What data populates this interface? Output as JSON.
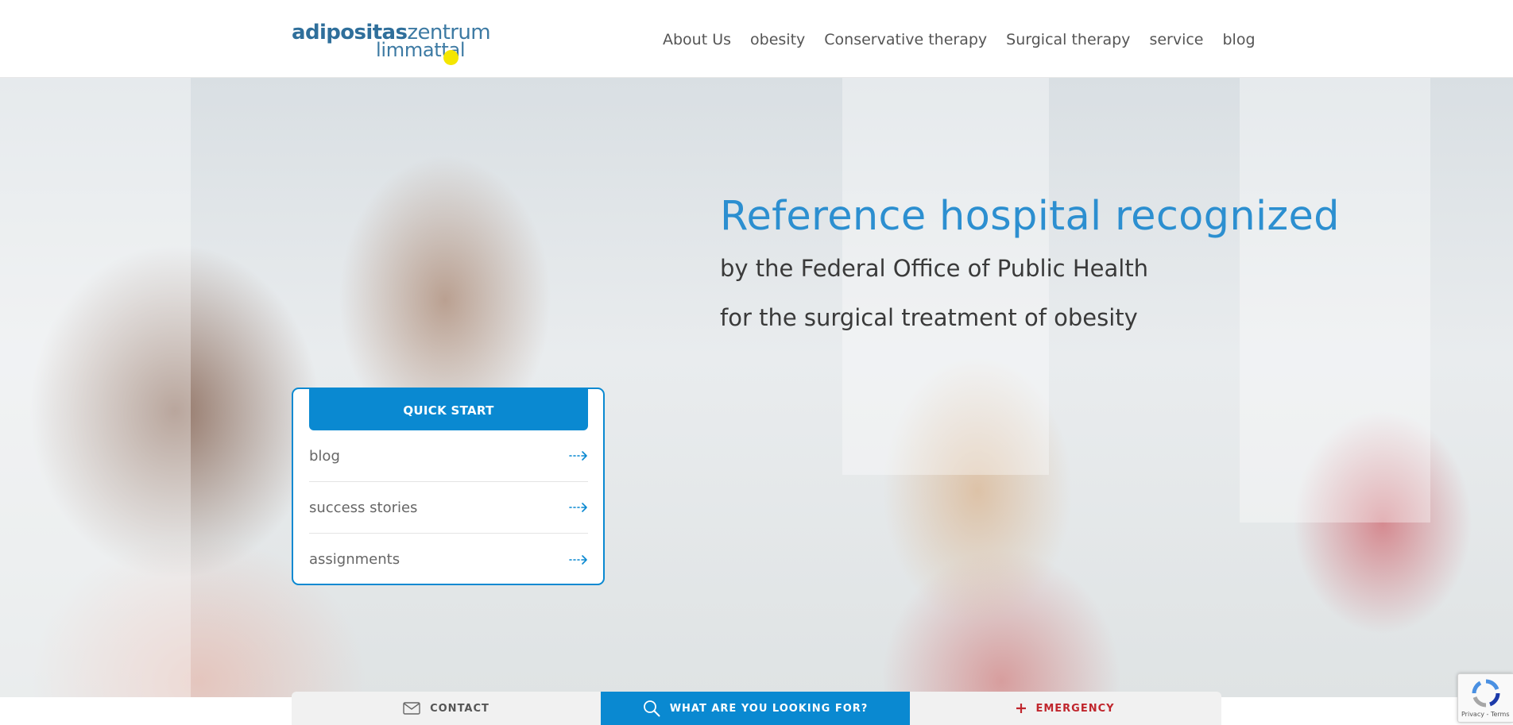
{
  "header": {
    "logo": {
      "part1": "adipositas",
      "part2": "zentrum",
      "part3": "limmattal"
    },
    "nav": [
      {
        "label": "About Us"
      },
      {
        "label": "obesity"
      },
      {
        "label": "Conservative therapy"
      },
      {
        "label": "Surgical therapy"
      },
      {
        "label": "service"
      },
      {
        "label": "blog"
      }
    ]
  },
  "hero": {
    "title": "Reference hospital recognized",
    "subtitle_line1": "by the Federal Office of Public Health",
    "subtitle_line2": "for the surgical treatment of obesity"
  },
  "quick_start": {
    "heading": "QUICK START",
    "items": [
      {
        "label": "blog"
      },
      {
        "label": "success stories"
      },
      {
        "label": "assignments"
      }
    ]
  },
  "bottom_bar": {
    "contact": "CONTACT",
    "search": "WHAT ARE YOU LOOKING FOR?",
    "emergency": "EMERGENCY"
  },
  "recaptcha": {
    "text": "Privacy - Terms"
  },
  "colors": {
    "accent": "#0a89d1",
    "title_blue": "#2c8fd0",
    "logo_blue": "#2f6f9b",
    "logo_dot": "#f4e600",
    "emergency_red": "#c0262d"
  },
  "icons": {
    "contact": "envelope-icon",
    "search": "magnifier-icon",
    "emergency": "plus-icon",
    "quick_item": "dotted-arrow-right-icon"
  }
}
